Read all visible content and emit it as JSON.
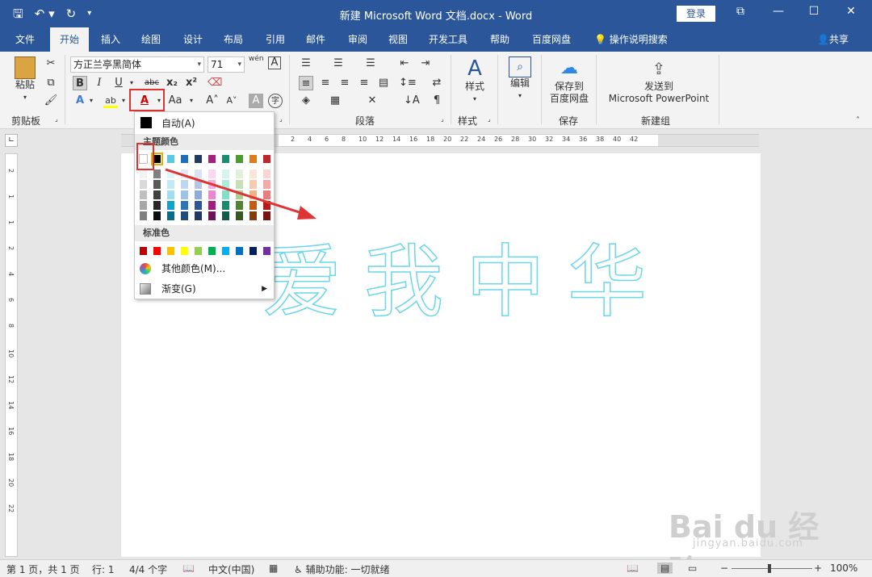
{
  "window": {
    "title": "新建 Microsoft Word 文档.docx  -  Word",
    "login_label": "登录",
    "controls": {
      "ribbon_display": "⧉",
      "minimize": "—",
      "restore": "☐",
      "close": "✕"
    }
  },
  "tabs": [
    "文件",
    "开始",
    "插入",
    "绘图",
    "设计",
    "布局",
    "引用",
    "邮件",
    "审阅",
    "视图",
    "开发工具",
    "帮助",
    "百度网盘"
  ],
  "tell_me": "操作说明搜索",
  "share": "共享",
  "ribbon": {
    "clipboard": {
      "paste": "粘贴",
      "group": "剪贴板"
    },
    "font": {
      "name": "方正兰亭黑简体",
      "size": "71",
      "phonetic": "wén"
    },
    "paragraph": {
      "group": "段落"
    },
    "styles": {
      "label": "样式",
      "group": "样式"
    },
    "editing": {
      "label": "编辑"
    },
    "save": {
      "label1": "保存到",
      "label2": "百度网盘",
      "group": "保存"
    },
    "send": {
      "label1": "发送到",
      "label2": "Microsoft PowerPoint",
      "group": "新建组"
    }
  },
  "ruler_ticks": [
    "2",
    "4",
    "6",
    "8",
    "10",
    "12",
    "14",
    "16",
    "18",
    "20",
    "22",
    "24",
    "26",
    "28",
    "30",
    "32",
    "34",
    "36",
    "38",
    "40",
    "42"
  ],
  "vruler_ticks": [
    "2",
    "1",
    "1",
    "2",
    "4",
    "6",
    "8",
    "10",
    "12",
    "14",
    "16",
    "18",
    "20",
    "22"
  ],
  "document_text": "爱我中华",
  "color_menu": {
    "auto": "自动(A)",
    "theme_header": "主题颜色",
    "standard_header": "标准色",
    "more_colors": "其他颜色(M)...",
    "gradient": "渐变(G)",
    "theme_top": [
      "#ffffff",
      "#000000",
      "#e7e6e6",
      "#44546a",
      "#4472c4",
      "#ed7d31",
      "#a5a5a5",
      "#ffc000",
      "#5b9bd5",
      "#70ad47"
    ],
    "theme_palette_cols": [
      [
        "#f2f2f2",
        "#d9d9d9",
        "#bfbfbf",
        "#a6a6a6",
        "#808080"
      ],
      [
        "#808080",
        "#595959",
        "#404040",
        "#262626",
        "#0d0d0d"
      ],
      [
        "#e0f4fb",
        "#c1e9f6",
        "#a2def2",
        "#0fa3cc",
        "#0a6d88"
      ],
      [
        "#deebf7",
        "#bdd7ee",
        "#9dc3e6",
        "#2e75b6",
        "#1f4e79"
      ],
      [
        "#dae3f3",
        "#b4c7e7",
        "#8faadc",
        "#2f5597",
        "#203864"
      ],
      [
        "#f8d7ef",
        "#f1afdf",
        "#ea87cf",
        "#a01f7e",
        "#6b1554"
      ],
      [
        "#d5f5ec",
        "#abebd9",
        "#81e1c6",
        "#1a8a6b",
        "#115c47"
      ],
      [
        "#e2f0d9",
        "#c5e0b4",
        "#a9d18e",
        "#548235",
        "#385723"
      ],
      [
        "#fbe5d6",
        "#f8cbad",
        "#f4b183",
        "#c55a11",
        "#843c0c"
      ],
      [
        "#f8d4d4",
        "#f1a9a9",
        "#ea7e7e",
        "#b31c1c",
        "#771313"
      ]
    ],
    "theme_top_display": [
      "#ffffff",
      "#000000",
      "#5bc8e8",
      "#1f6fb6",
      "#1f3864",
      "#a0247e",
      "#1d8f6f",
      "#4f9a2e",
      "#e07a1f",
      "#c0272d"
    ],
    "standard": [
      "#c00000",
      "#ff0000",
      "#ffc000",
      "#ffff00",
      "#92d050",
      "#00b050",
      "#00b0f0",
      "#0070c0",
      "#002060",
      "#7030a0"
    ]
  },
  "status": {
    "page": "第 1 页，共 1 页",
    "line": "行: 1",
    "words": "4/4 个字",
    "lang": "中文(中国)",
    "accessibility": "辅助功能: 一切就绪",
    "zoom": "100%"
  },
  "watermark": {
    "brand": "Bai du 经验",
    "site": "jingyan.baidu.com"
  }
}
